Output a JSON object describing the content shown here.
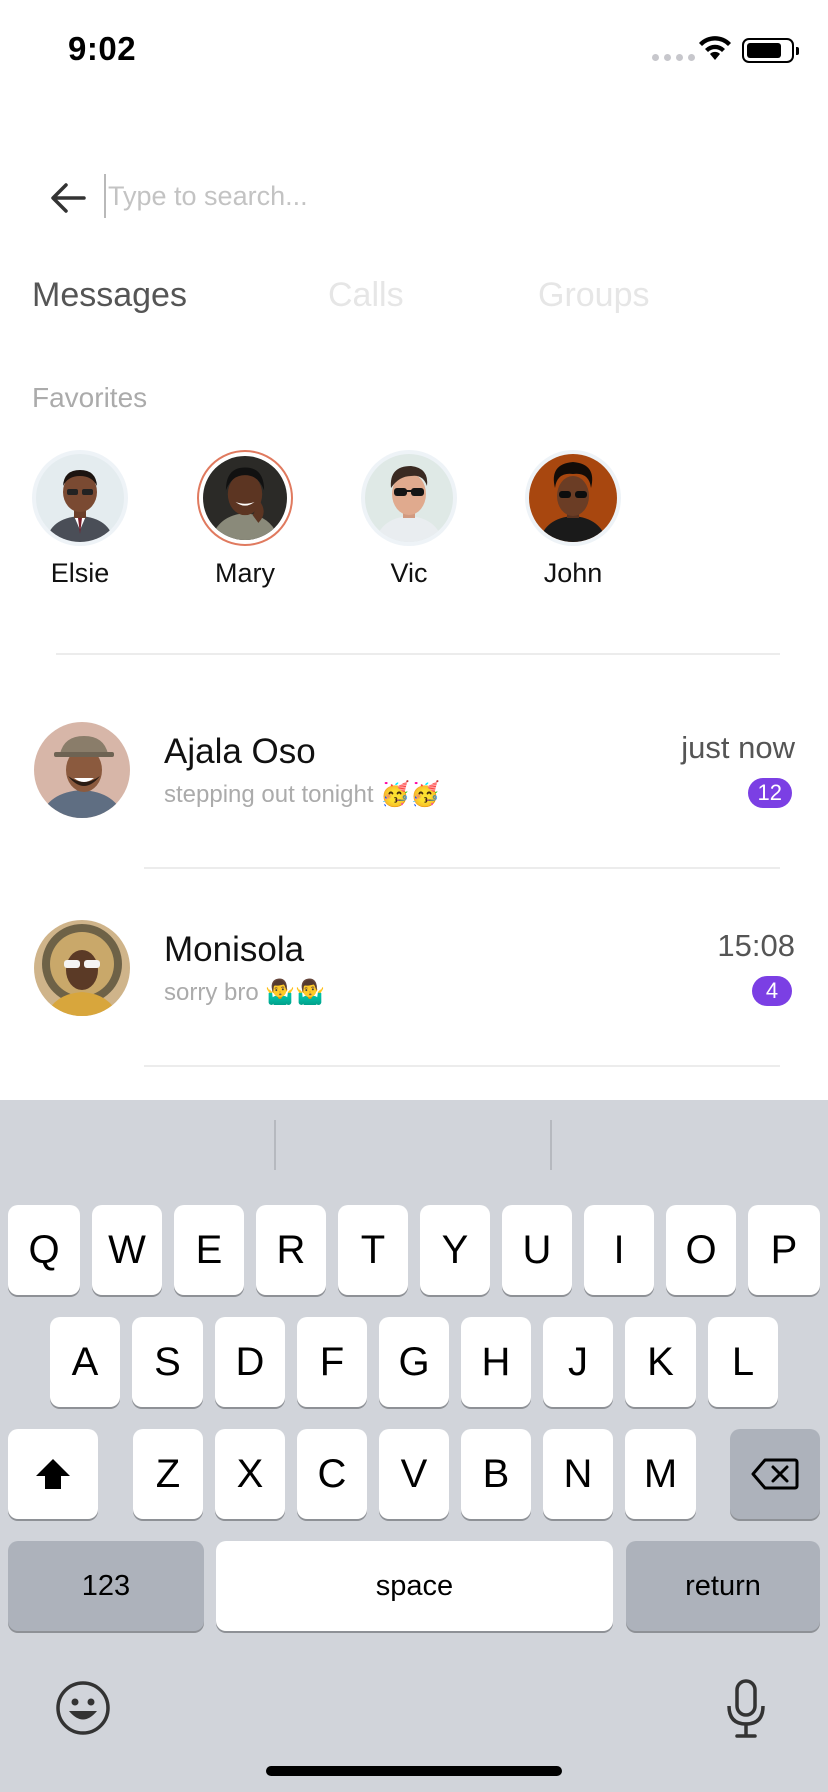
{
  "status_bar": {
    "time": "9:02"
  },
  "search": {
    "placeholder": "Type to search...",
    "value": ""
  },
  "tabs": [
    {
      "label": "Messages",
      "active": true
    },
    {
      "label": "Calls",
      "active": false
    },
    {
      "label": "Groups",
      "active": false
    }
  ],
  "favorites": {
    "title": "Favorites",
    "items": [
      {
        "name": "Elsie"
      },
      {
        "name": "Mary"
      },
      {
        "name": "Vic"
      },
      {
        "name": "John"
      }
    ]
  },
  "chats": [
    {
      "name": "Ajala Oso",
      "message": "stepping out tonight 🥳🥳",
      "time": "just now",
      "unread": "12"
    },
    {
      "name": "Monisola",
      "message": "sorry bro 🤷‍♂️🤷‍♂️",
      "time": "15:08",
      "unread": "4"
    }
  ],
  "keyboard": {
    "row1": [
      "Q",
      "W",
      "E",
      "R",
      "T",
      "Y",
      "U",
      "I",
      "O",
      "P"
    ],
    "row2": [
      "A",
      "S",
      "D",
      "F",
      "G",
      "H",
      "J",
      "K",
      "L"
    ],
    "row3": [
      "Z",
      "X",
      "C",
      "V",
      "B",
      "N",
      "M"
    ],
    "numbers_label": "123",
    "space_label": "space",
    "return_label": "return"
  },
  "colors": {
    "accent": "#7b3fe4",
    "favorite_ring": "#e07a5f",
    "keyboard_bg": "#d1d4da"
  }
}
